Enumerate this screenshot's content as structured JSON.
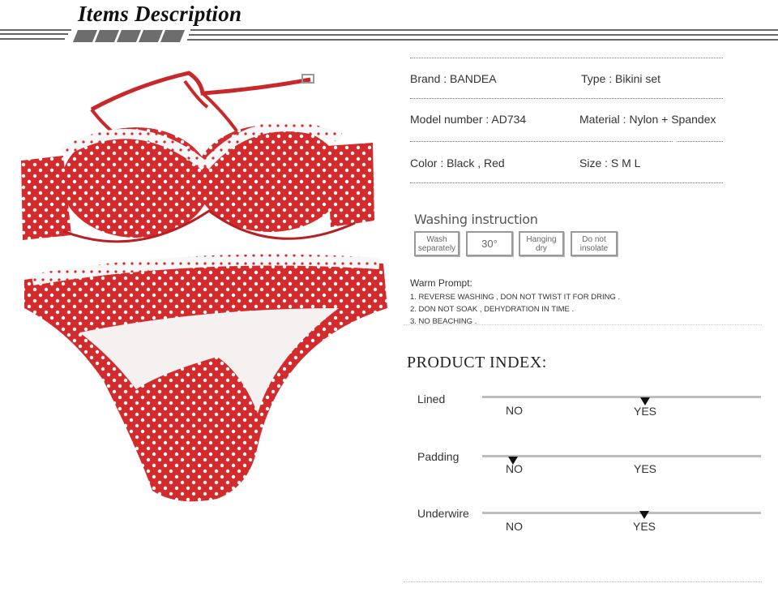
{
  "header": {
    "title": "Items Description"
  },
  "specs": {
    "brand": "Brand : BANDEA",
    "type": "Type : Bikini set",
    "model": "Model number : AD734",
    "material": "Material : Nylon + Spandex",
    "color": "Color : Black , Red",
    "size": "Size :  S  M  L"
  },
  "washing": {
    "title": "Washing instruction",
    "boxes": [
      {
        "line1": "Wash",
        "line2": "separately"
      },
      {
        "line1": "30°",
        "line2": ""
      },
      {
        "line1": "Hanging",
        "line2": "dry"
      },
      {
        "line1": "Do not",
        "line2": "insolate"
      }
    ]
  },
  "warm_prompt": {
    "title": "Warm Prompt:",
    "lines": [
      "1. REVERSE WASHING , DON NOT TWIST IT FOR DRING .",
      "2. DON NOT SOAK , DEHYDRATION IN TIME .",
      "3. NO BEACHING ."
    ]
  },
  "product_index": {
    "title": "PRODUCT INDEX:",
    "rows": [
      {
        "label": "Lined",
        "no": "NO",
        "yes": "YES",
        "selected": "YES"
      },
      {
        "label": "Padding",
        "no": "NO",
        "yes": "YES",
        "selected": "NO"
      },
      {
        "label": "Underwire",
        "no": "NO",
        "yes": "YES",
        "selected": "YES"
      }
    ]
  },
  "colors": {
    "accent_red": "#d42a2c",
    "bar_gray": "#bdbdbd"
  }
}
